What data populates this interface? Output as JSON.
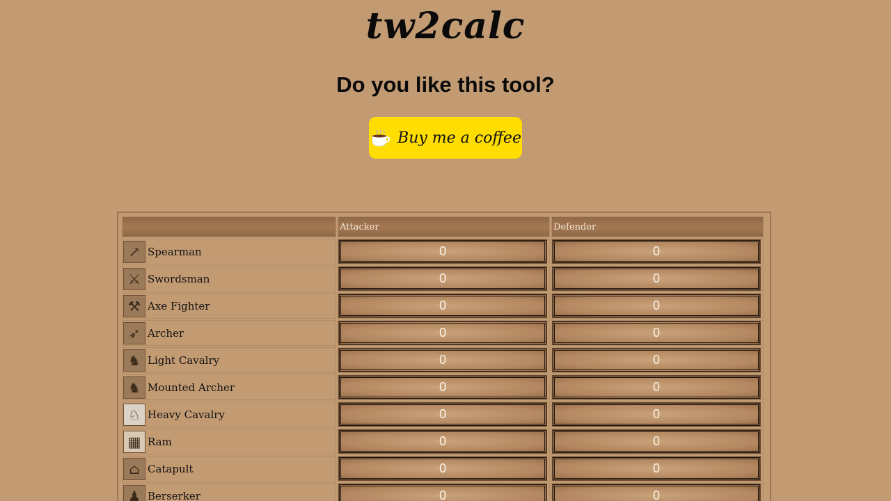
{
  "logo": "tw2calc",
  "promo": {
    "heading": "Do you like this tool?",
    "button_label": "Buy me a coffee"
  },
  "table": {
    "headers": [
      "",
      "Attacker",
      "Defender"
    ],
    "rows": [
      {
        "unit": "Spearman",
        "icon": "spear-icon",
        "attacker": "0",
        "defender": "0"
      },
      {
        "unit": "Swordsman",
        "icon": "sword-icon",
        "attacker": "0",
        "defender": "0"
      },
      {
        "unit": "Axe Fighter",
        "icon": "axe-icon",
        "attacker": "0",
        "defender": "0"
      },
      {
        "unit": "Archer",
        "icon": "bow-icon",
        "attacker": "0",
        "defender": "0"
      },
      {
        "unit": "Light Cavalry",
        "icon": "light-cavalry-icon",
        "attacker": "0",
        "defender": "0"
      },
      {
        "unit": "Mounted Archer",
        "icon": "mounted-archer-icon",
        "attacker": "0",
        "defender": "0"
      },
      {
        "unit": "Heavy Cavalry",
        "icon": "heavy-cavalry-icon",
        "attacker": "0",
        "defender": "0"
      },
      {
        "unit": "Ram",
        "icon": "ram-icon",
        "attacker": "0",
        "defender": "0"
      },
      {
        "unit": "Catapult",
        "icon": "catapult-icon",
        "attacker": "0",
        "defender": "0"
      },
      {
        "unit": "Berserker",
        "icon": "berserker-icon",
        "attacker": "0",
        "defender": "0"
      }
    ]
  },
  "colors": {
    "background": "#c39b73",
    "button": "#ffdd00"
  }
}
